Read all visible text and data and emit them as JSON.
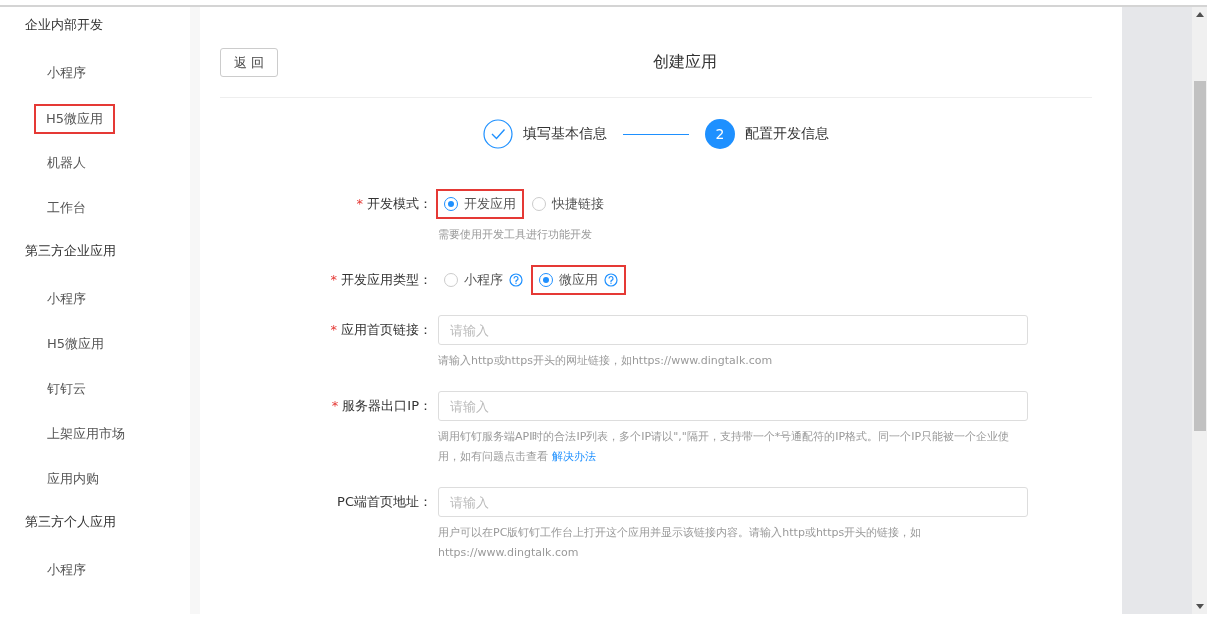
{
  "sidebar": {
    "sections": [
      {
        "title": "企业内部开发",
        "items": [
          {
            "label": "小程序",
            "highlighted": false
          },
          {
            "label": "H5微应用",
            "highlighted": true
          },
          {
            "label": "机器人",
            "highlighted": false
          },
          {
            "label": "工作台",
            "highlighted": false
          }
        ]
      },
      {
        "title": "第三方企业应用",
        "items": [
          {
            "label": "小程序",
            "highlighted": false
          },
          {
            "label": "H5微应用",
            "highlighted": false
          },
          {
            "label": "钉钉云",
            "highlighted": false
          },
          {
            "label": "上架应用市场",
            "highlighted": false
          },
          {
            "label": "应用内购",
            "highlighted": false
          }
        ]
      },
      {
        "title": "第三方个人应用",
        "items": [
          {
            "label": "小程序",
            "highlighted": false
          }
        ]
      }
    ]
  },
  "header": {
    "back_button": "返 回",
    "title": "创建应用"
  },
  "steps": [
    {
      "label": "填写基本信息",
      "completed": true
    },
    {
      "label": "配置开发信息",
      "completed": false,
      "number": "2"
    }
  ],
  "form": {
    "fields": [
      {
        "kind": "radio",
        "label": "开发模式：",
        "required_mark": "*",
        "options": [
          {
            "label": "开发应用",
            "selected": true,
            "help": false,
            "highlighted": true
          },
          {
            "label": "快捷链接",
            "selected": false,
            "help": false,
            "highlighted": false
          }
        ],
        "hint": "需要使用开发工具进行功能开发"
      },
      {
        "kind": "radio",
        "label": "开发应用类型：",
        "required_mark": "*",
        "options": [
          {
            "label": "小程序",
            "selected": false,
            "help": true,
            "highlighted": false
          },
          {
            "label": "微应用",
            "selected": true,
            "help": true,
            "highlighted": true
          }
        ]
      },
      {
        "kind": "input",
        "label": "应用首页链接：",
        "required_mark": "*",
        "placeholder": "请输入",
        "hint": "请输入http或https开头的网址链接，如https://www.dingtalk.com"
      },
      {
        "kind": "input",
        "label": "服务器出口IP：",
        "required_mark": "*",
        "placeholder": "请输入",
        "hint": "调用钉钉服务端API时的合法IP列表，多个IP请以\",\"隔开，支持带一个*号通配符的IP格式。同一个IP只能被一个企业使用，如有问题点击查看 ",
        "hint_link": "解决办法"
      },
      {
        "kind": "input",
        "label": "PC端首页地址：",
        "placeholder": "请输入",
        "hint": "用户可以在PC版钉钉工作台上打开这个应用并显示该链接内容。请输入http或https开头的链接，如https://www.dingtalk.com"
      }
    ]
  }
}
